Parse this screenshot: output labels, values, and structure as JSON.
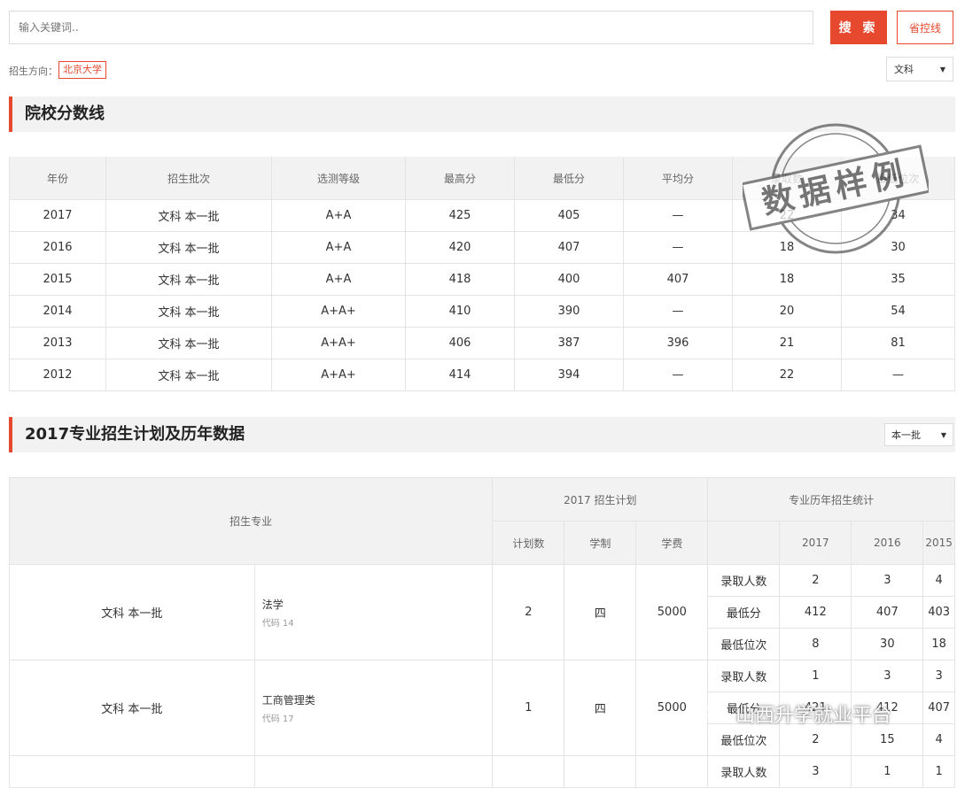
{
  "search": {
    "placeholder": "输入关键词..",
    "button_label": "搜 索",
    "line_button_label": "省控线"
  },
  "direction": {
    "label": "招生方向：",
    "value": "北京大学"
  },
  "subject_select": {
    "value": "文科"
  },
  "score_section": {
    "title": "院校分数线",
    "headers": [
      "年份",
      "招生批次",
      "选测等级",
      "最高分",
      "最低分",
      "平均分",
      "录取数",
      "最低位次"
    ],
    "rows": [
      [
        "2017",
        "文科 本一批",
        "A+A",
        "425",
        "405",
        "—",
        "22",
        "34"
      ],
      [
        "2016",
        "文科 本一批",
        "A+A",
        "420",
        "407",
        "—",
        "18",
        "30"
      ],
      [
        "2015",
        "文科 本一批",
        "A+A",
        "418",
        "400",
        "407",
        "18",
        "35"
      ],
      [
        "2014",
        "文科 本一批",
        "A+A+",
        "410",
        "390",
        "—",
        "20",
        "54"
      ],
      [
        "2013",
        "文科 本一批",
        "A+A+",
        "406",
        "387",
        "396",
        "21",
        "81"
      ],
      [
        "2012",
        "文科 本一批",
        "A+A+",
        "414",
        "394",
        "—",
        "22",
        "—"
      ]
    ]
  },
  "plan_section": {
    "title": "2017专业招生计划及历年数据",
    "batch_select": "本一批",
    "headers": {
      "major": "招生专业",
      "plan_group": "2017 招生计划",
      "stats_group": "专业历年招生统计",
      "plan_cols": [
        "计划数",
        "学制",
        "学费"
      ],
      "years": [
        "2017",
        "2016",
        "2015"
      ]
    },
    "majors": [
      {
        "batch": "文科 本一批",
        "name": "法学",
        "code": "代码 14",
        "plan": "2",
        "years": "四",
        "fee": "5000",
        "stats": [
          {
            "label": "录取人数",
            "values": [
              "2",
              "3",
              "4"
            ]
          },
          {
            "label": "最低分",
            "values": [
              "412",
              "407",
              "403"
            ]
          },
          {
            "label": "最低位次",
            "values": [
              "8",
              "30",
              "18"
            ]
          }
        ]
      },
      {
        "batch": "文科 本一批",
        "name": "工商管理类",
        "code": "代码 17",
        "plan": "1",
        "years": "四",
        "fee": "5000",
        "stats": [
          {
            "label": "录取人数",
            "values": [
              "1",
              "3",
              "3"
            ]
          },
          {
            "label": "最低分",
            "values": [
              "421",
              "412",
              "407"
            ]
          },
          {
            "label": "最低位次",
            "values": [
              "2",
              "15",
              "4"
            ]
          }
        ]
      },
      {
        "batch": "",
        "name": "",
        "code": "",
        "plan": "",
        "years": "",
        "fee": "",
        "stats": [
          {
            "label": "录取人数",
            "values": [
              "3",
              "1",
              "1"
            ]
          }
        ]
      }
    ]
  },
  "stamp": {
    "text": "数据样例"
  },
  "watermark": {
    "text": "山西升学就业平台"
  },
  "colors": {
    "accent": "#e6492d",
    "header_bg": "#f2f2f2"
  }
}
